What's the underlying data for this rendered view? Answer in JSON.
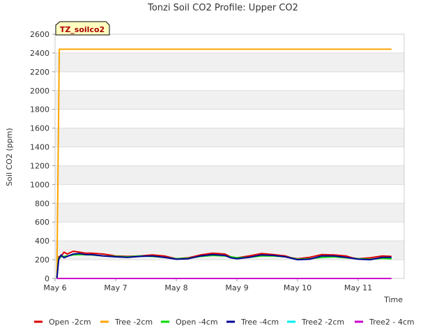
{
  "chart_data": {
    "type": "line",
    "title": "Tonzi Soil CO2 Profile: Upper CO2",
    "xlabel": "Time",
    "ylabel": "Soil CO2 (ppm)",
    "xlim": [
      0,
      5.55
    ],
    "ylim": [
      0,
      2600
    ],
    "x_ticks": [
      {
        "label": "May 6",
        "value": 0
      },
      {
        "label": "May 7",
        "value": 1
      },
      {
        "label": "May 8",
        "value": 2
      },
      {
        "label": "May 9",
        "value": 3
      },
      {
        "label": "May 10",
        "value": 4
      },
      {
        "label": "May 11",
        "value": 5
      }
    ],
    "y_ticks": [
      0,
      200,
      400,
      600,
      800,
      1000,
      1200,
      1400,
      1600,
      1800,
      2000,
      2200,
      2400,
      2600
    ],
    "grid": true,
    "background_bands": true,
    "legend_placement": "bottom",
    "annotation_box": "TZ_soilco2",
    "series": [
      {
        "name": "Open -2cm",
        "color": "#dd0000",
        "x": [
          0.03,
          0.06,
          0.1,
          0.15,
          0.2,
          0.3,
          0.4,
          0.5,
          0.6,
          0.8,
          1.0,
          1.2,
          1.4,
          1.6,
          1.8,
          2.0,
          2.2,
          2.4,
          2.6,
          2.8,
          2.9,
          3.0,
          3.2,
          3.4,
          3.6,
          3.8,
          3.9,
          4.0,
          4.2,
          4.4,
          4.6,
          4.8,
          4.9,
          5.0,
          5.2,
          5.4,
          5.55
        ],
        "y": [
          0,
          230,
          240,
          280,
          260,
          290,
          280,
          270,
          270,
          260,
          240,
          235,
          240,
          250,
          240,
          210,
          220,
          250,
          270,
          260,
          230,
          220,
          240,
          265,
          255,
          240,
          220,
          210,
          225,
          255,
          250,
          240,
          220,
          210,
          220,
          240,
          235
        ]
      },
      {
        "name": "Tree -2cm",
        "color": "#ffa500",
        "x": [
          0.03,
          0.07,
          0.1,
          1.0,
          2.0,
          3.0,
          4.0,
          5.0,
          5.55
        ],
        "y": [
          0,
          2440,
          2440,
          2440,
          2440,
          2440,
          2440,
          2440,
          2440
        ]
      },
      {
        "name": "Open -4cm",
        "color": "#00dd00",
        "x": [
          0.03,
          0.06,
          0.1,
          0.2,
          0.3,
          0.4,
          0.6,
          0.8,
          1.0,
          1.2,
          1.4,
          1.6,
          1.8,
          2.0,
          2.2,
          2.4,
          2.6,
          2.8,
          3.0,
          3.2,
          3.4,
          3.6,
          3.8,
          4.0,
          4.2,
          4.4,
          4.6,
          4.8,
          5.0,
          5.2,
          5.4,
          5.55
        ],
        "y": [
          0,
          220,
          230,
          240,
          250,
          255,
          250,
          240,
          235,
          230,
          240,
          235,
          225,
          210,
          215,
          235,
          245,
          240,
          220,
          225,
          240,
          240,
          230,
          205,
          210,
          225,
          230,
          220,
          210,
          205,
          215,
          210
        ]
      },
      {
        "name": "Tree -4cm",
        "color": "#000099",
        "x": [
          0.03,
          0.06,
          0.1,
          0.15,
          0.2,
          0.3,
          0.4,
          0.5,
          0.6,
          0.8,
          1.0,
          1.2,
          1.4,
          1.6,
          1.8,
          2.0,
          2.2,
          2.4,
          2.6,
          2.8,
          2.9,
          3.0,
          3.2,
          3.4,
          3.6,
          3.8,
          4.0,
          4.2,
          4.4,
          4.6,
          4.8,
          5.0,
          5.2,
          5.4,
          5.55
        ],
        "y": [
          0,
          200,
          250,
          220,
          235,
          260,
          265,
          255,
          255,
          240,
          230,
          225,
          235,
          240,
          225,
          205,
          210,
          240,
          255,
          245,
          220,
          210,
          225,
          250,
          245,
          230,
          200,
          205,
          240,
          240,
          225,
          205,
          200,
          225,
          225
        ]
      },
      {
        "name": "Tree2 -2cm",
        "color": "#00eeee",
        "x": [
          0.03,
          1.0,
          2.0,
          3.0,
          4.0,
          5.0,
          5.55
        ],
        "y": [
          0,
          0,
          0,
          0,
          0,
          0,
          0
        ]
      },
      {
        "name": "Tree2 - 4cm",
        "color": "#cc00cc",
        "x": [
          0.03,
          1.0,
          2.0,
          3.0,
          4.0,
          5.0,
          5.55
        ],
        "y": [
          0,
          0,
          0,
          0,
          0,
          0,
          0
        ]
      }
    ]
  }
}
